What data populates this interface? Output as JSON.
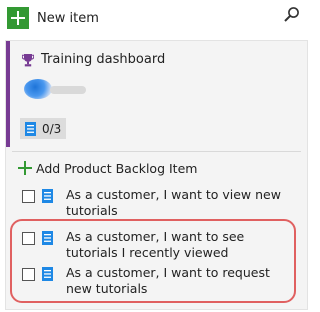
{
  "toolbar": {
    "new_item_label": "New item",
    "new_item_icon": "plus-icon",
    "search_icon": "search-icon",
    "accent_color": "#339933"
  },
  "card": {
    "title": "Training dashboard",
    "title_icon": "trophy-icon",
    "accent_color": "#773b93",
    "task_counter": "0/3"
  },
  "add_backlog_label": "Add Product Backlog Item",
  "tasks": [
    {
      "text": "As a customer, I want to view new tutorials",
      "checked": false
    },
    {
      "text": "As a customer, I want to see tutorials I recently viewed",
      "checked": false
    },
    {
      "text": "As a customer, I want to request new tutorials",
      "checked": false
    }
  ],
  "highlight_color": "#e06060"
}
